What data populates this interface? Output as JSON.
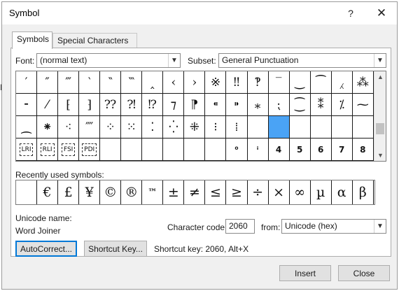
{
  "window": {
    "title": "Symbol",
    "help_label": "?",
    "close_glyph": "✕"
  },
  "background": {
    "partial_text": "H"
  },
  "tabs": [
    {
      "label": "Symbols",
      "active": true
    },
    {
      "label": "Special Characters",
      "active": false
    }
  ],
  "font": {
    "label": "Font:",
    "value": "(normal text)"
  },
  "subset": {
    "label": "Subset:",
    "value": "General Punctuation"
  },
  "symbol_grid": {
    "rows": [
      [
        "′",
        "″",
        "‴",
        "‵",
        "‶",
        "‷",
        "‸",
        "‹",
        "›",
        "※",
        "‼",
        "‽",
        "‾",
        "‿",
        "⁀",
        "⁁",
        "⁂"
      ],
      [
        "⁃",
        "⁄",
        "⁅",
        "⁆",
        "⁇",
        "⁈",
        "⁉",
        "⁊",
        "⁋",
        "⁌",
        "⁍",
        "⁎",
        "⁏",
        "⁐",
        "⁑",
        "⁒",
        "⁓"
      ],
      [
        "⁔",
        "⁕",
        "⁖",
        "⁗",
        "⁘",
        "⁙",
        "⁚",
        "⁛",
        "⁜",
        "⁝",
        "⁞",
        "",
        "",
        "",
        "",
        "",
        ""
      ],
      [
        "LRI",
        "RLI",
        "FSI",
        "PDI",
        "",
        "",
        "",
        "",
        "",
        "",
        "⁰",
        "ⁱ",
        "4",
        "5",
        "6",
        "7",
        "8"
      ]
    ],
    "selected": {
      "row": 2,
      "col": 12
    },
    "boxed_labels": [
      "LRI",
      "RLI",
      "FSI",
      "PDI"
    ]
  },
  "recent": {
    "label": "Recently used symbols:",
    "symbols": [
      "",
      "€",
      "£",
      "¥",
      "©",
      "®",
      "™",
      "±",
      "≠",
      "≤",
      "≥",
      "÷",
      "×",
      "∞",
      "µ",
      "α",
      "β"
    ]
  },
  "unicode": {
    "name_label": "Unicode name:",
    "name_value": "Word Joiner"
  },
  "character_code": {
    "label": "Character code:",
    "value": "2060"
  },
  "from": {
    "label": "from:",
    "value": "Unicode (hex)"
  },
  "buttons": {
    "autocorrect": "AutoCorrect...",
    "shortcut_key": "Shortcut Key...",
    "insert": "Insert",
    "close": "Close"
  },
  "shortcut_key_text": "Shortcut key: 2060, Alt+X",
  "colors": {
    "selected_cell": "#4aa3f5",
    "focus_border": "#0078d7"
  }
}
